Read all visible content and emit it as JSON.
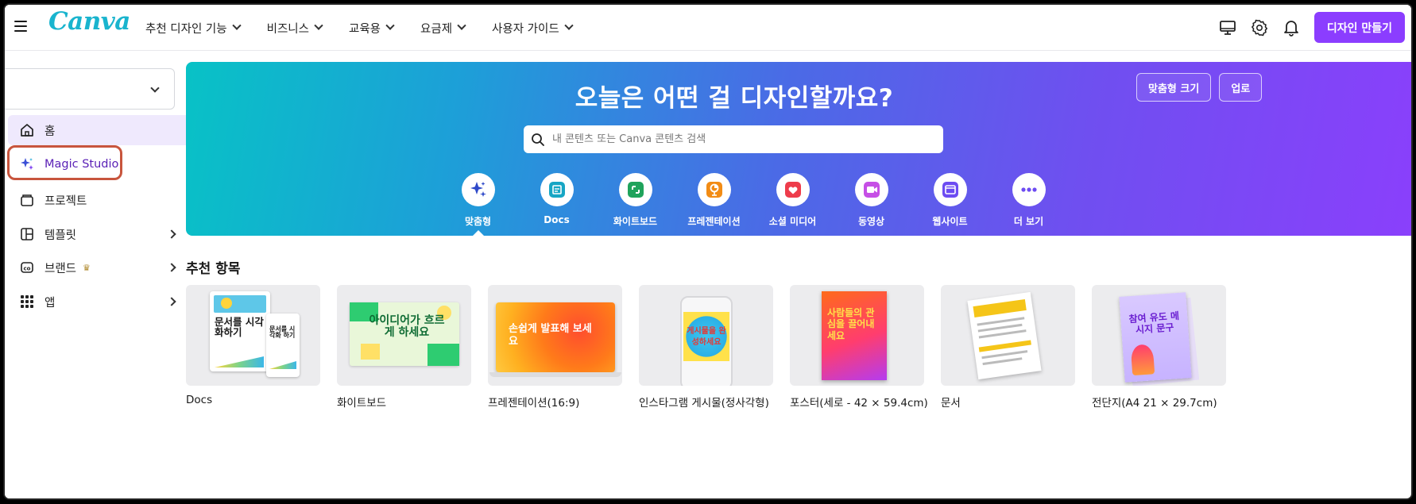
{
  "header": {
    "logo": "Canva",
    "nav": [
      "추천 디자인 기능",
      "비즈니스",
      "교육용",
      "요금제",
      "사용자 가이드"
    ],
    "create_button": "디자인 만들기",
    "accent": "#8b3dff"
  },
  "sidebar": {
    "items": [
      {
        "label": "홈",
        "icon": "home-icon",
        "active": true
      },
      {
        "label": "Magic Studio",
        "icon": "sparkle-icon"
      },
      {
        "label": "프로젝트",
        "icon": "folder-icon"
      },
      {
        "label": "템플릿",
        "icon": "template-icon",
        "expandable": true
      },
      {
        "label": "브랜드",
        "icon": "brand-icon",
        "expandable": true,
        "badge": "crown-icon"
      },
      {
        "label": "앱",
        "icon": "apps-grid-icon",
        "expandable": true
      }
    ]
  },
  "hero": {
    "title": "오늘은 어떤 걸 디자인할까요?",
    "buttons": [
      "맞춤형 크기",
      "업로"
    ],
    "search_placeholder": "내 콘텐츠 또는 Canva 콘텐츠 검색",
    "categories": [
      {
        "label": "맞춤형",
        "icon": "sparkle-icon",
        "color": "#2e49c9"
      },
      {
        "label": "Docs",
        "icon": "docs-icon",
        "color": "#17a6c4"
      },
      {
        "label": "화이트보드",
        "icon": "whiteboard-icon",
        "color": "#1fa35c"
      },
      {
        "label": "프레젠테이션",
        "icon": "presentation-icon",
        "color": "#f28c15"
      },
      {
        "label": "소셜 미디어",
        "icon": "heart-icon",
        "color": "#ee3c4b"
      },
      {
        "label": "동영상",
        "icon": "video-icon",
        "color": "#c64fe6"
      },
      {
        "label": "웹사이트",
        "icon": "website-icon",
        "color": "#6d4cf2"
      },
      {
        "label": "더 보기",
        "icon": "more-icon",
        "color": "#6d4cf2"
      }
    ]
  },
  "recommended": {
    "title": "추천 항목",
    "cards": [
      {
        "label": "Docs",
        "thumb_text": "문서를 시각화하기",
        "thumb_text_small": "문서를 시각화 하기"
      },
      {
        "label": "화이트보드",
        "thumb_text": "아이디어가 흐르게 하세요"
      },
      {
        "label": "프레젠테이션(16:9)",
        "thumb_text": "손쉽게 발표해 보세요"
      },
      {
        "label": "인스타그램 게시물(정사각형)",
        "thumb_text": "게시물을 완성하세요"
      },
      {
        "label": "포스터(세로 - 42 × 59.4cm)",
        "thumb_text": "사람들의 관심을 끌어내세요"
      },
      {
        "label": "문서",
        "thumb_text": ""
      },
      {
        "label": "전단지(A4 21 × 29.7cm)",
        "thumb_text": "참여 유도 메시지 문구"
      }
    ]
  }
}
